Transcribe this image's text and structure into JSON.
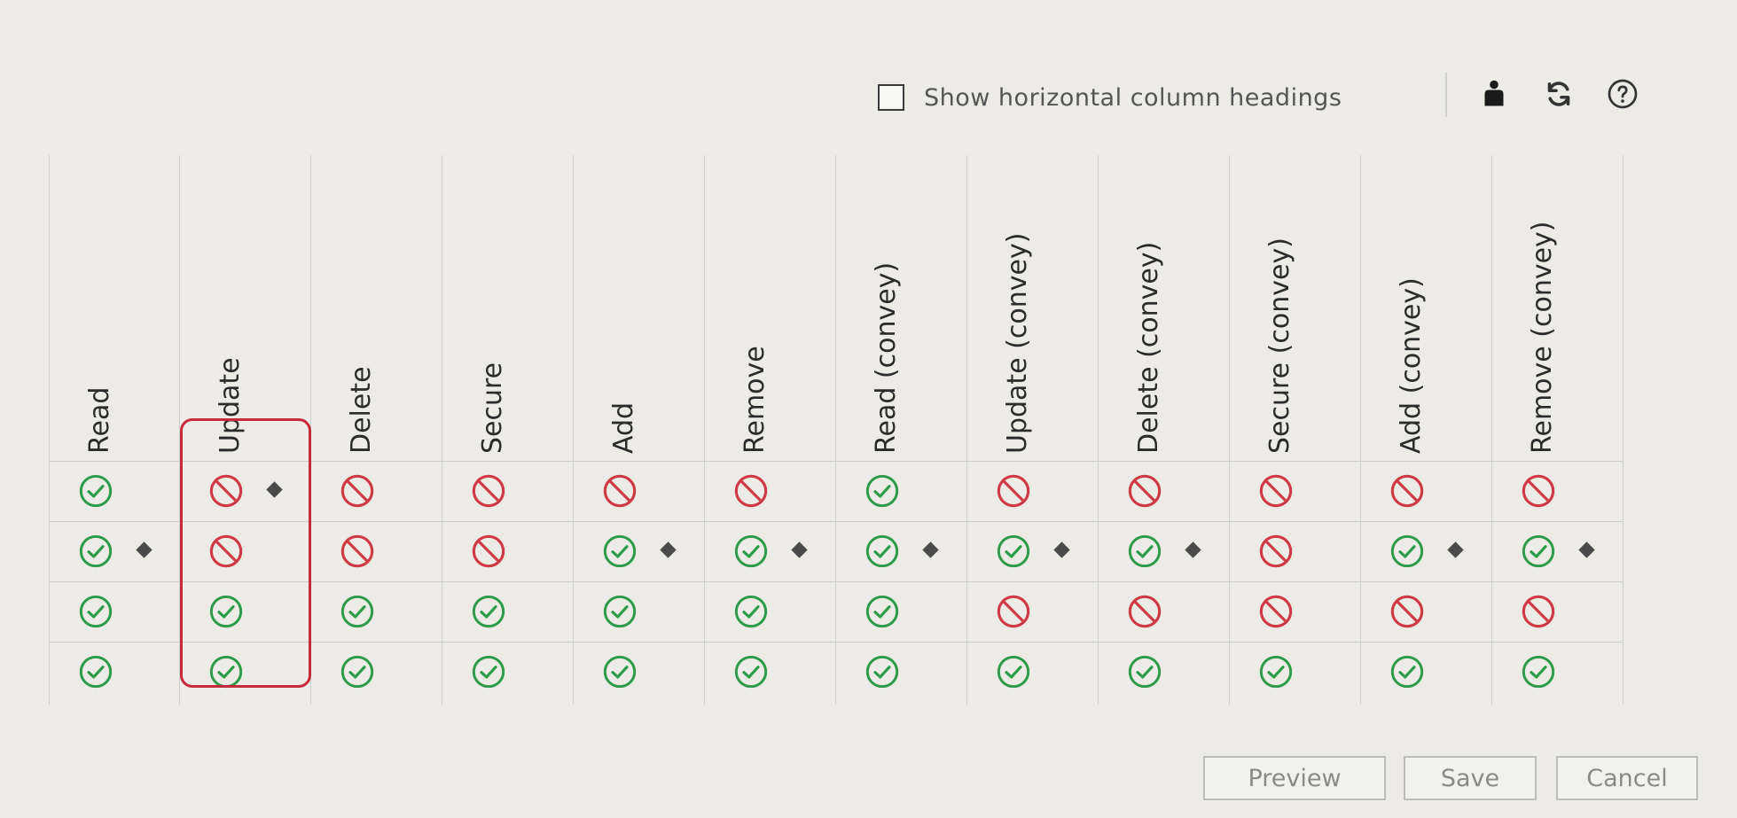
{
  "options": {
    "show_horizontal_label": "Show horizontal column headings",
    "show_horizontal_checked": false
  },
  "toolbar": {
    "icons": [
      "person-icon",
      "refresh-icon",
      "help-icon"
    ]
  },
  "colors": {
    "allow": "#2e9b4a",
    "deny": "#d03a45",
    "highlight": "#c52b3a"
  },
  "permissions": {
    "columns": [
      {
        "label": "Read",
        "highlighted": false,
        "cells": [
          {
            "state": "allow",
            "marked": false
          },
          {
            "state": "allow",
            "marked": true
          },
          {
            "state": "allow",
            "marked": false
          },
          {
            "state": "allow",
            "marked": false
          }
        ]
      },
      {
        "label": "Update",
        "highlighted": true,
        "cells": [
          {
            "state": "deny",
            "marked": true
          },
          {
            "state": "deny",
            "marked": false
          },
          {
            "state": "allow",
            "marked": false
          },
          {
            "state": "allow",
            "marked": false
          }
        ]
      },
      {
        "label": "Delete",
        "highlighted": false,
        "cells": [
          {
            "state": "deny",
            "marked": false
          },
          {
            "state": "deny",
            "marked": false
          },
          {
            "state": "allow",
            "marked": false
          },
          {
            "state": "allow",
            "marked": false
          }
        ]
      },
      {
        "label": "Secure",
        "highlighted": false,
        "cells": [
          {
            "state": "deny",
            "marked": false
          },
          {
            "state": "deny",
            "marked": false
          },
          {
            "state": "allow",
            "marked": false
          },
          {
            "state": "allow",
            "marked": false
          }
        ]
      },
      {
        "label": "Add",
        "highlighted": false,
        "cells": [
          {
            "state": "deny",
            "marked": false
          },
          {
            "state": "allow",
            "marked": true
          },
          {
            "state": "allow",
            "marked": false
          },
          {
            "state": "allow",
            "marked": false
          }
        ]
      },
      {
        "label": "Remove",
        "highlighted": false,
        "cells": [
          {
            "state": "deny",
            "marked": false
          },
          {
            "state": "allow",
            "marked": true
          },
          {
            "state": "allow",
            "marked": false
          },
          {
            "state": "allow",
            "marked": false
          }
        ]
      },
      {
        "label": "Read (convey)",
        "highlighted": false,
        "cells": [
          {
            "state": "allow",
            "marked": false
          },
          {
            "state": "allow",
            "marked": true
          },
          {
            "state": "allow",
            "marked": false
          },
          {
            "state": "allow",
            "marked": false
          }
        ]
      },
      {
        "label": "Update (convey)",
        "highlighted": false,
        "cells": [
          {
            "state": "deny",
            "marked": false
          },
          {
            "state": "allow",
            "marked": true
          },
          {
            "state": "deny",
            "marked": false
          },
          {
            "state": "allow",
            "marked": false
          }
        ]
      },
      {
        "label": "Delete (convey)",
        "highlighted": false,
        "cells": [
          {
            "state": "deny",
            "marked": false
          },
          {
            "state": "allow",
            "marked": true
          },
          {
            "state": "deny",
            "marked": false
          },
          {
            "state": "allow",
            "marked": false
          }
        ]
      },
      {
        "label": "Secure (convey)",
        "highlighted": false,
        "cells": [
          {
            "state": "deny",
            "marked": false
          },
          {
            "state": "deny",
            "marked": false
          },
          {
            "state": "deny",
            "marked": false
          },
          {
            "state": "allow",
            "marked": false
          }
        ]
      },
      {
        "label": "Add (convey)",
        "highlighted": false,
        "cells": [
          {
            "state": "deny",
            "marked": false
          },
          {
            "state": "allow",
            "marked": true
          },
          {
            "state": "deny",
            "marked": false
          },
          {
            "state": "allow",
            "marked": false
          }
        ]
      },
      {
        "label": "Remove (convey)",
        "highlighted": false,
        "cells": [
          {
            "state": "deny",
            "marked": false
          },
          {
            "state": "allow",
            "marked": true
          },
          {
            "state": "deny",
            "marked": false
          },
          {
            "state": "allow",
            "marked": false
          }
        ]
      }
    ]
  },
  "footer": {
    "preview_label": "Preview",
    "save_label": "Save",
    "cancel_label": "Cancel"
  }
}
